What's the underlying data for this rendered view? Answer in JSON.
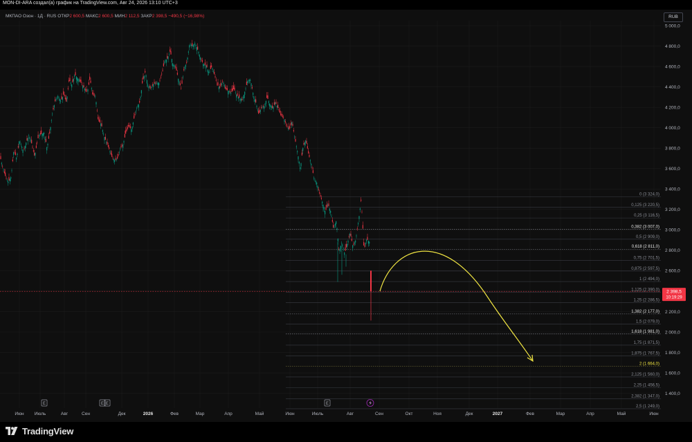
{
  "header": {
    "title": "MON-DI-ARA создал(а) график на TradingView.com, Авг 24, 2026 13:10 UTC+3"
  },
  "legend": {
    "symbol": "МКПАО Озон · 1Д · RUS",
    "open_label": "ОТКР",
    "open_value": "2 600,5",
    "high_label": "МАКС",
    "high_value": "2 600,5",
    "low_label": "МИН",
    "low_value": "2 112,5",
    "close_label": "ЗАКР",
    "close_value": "2 398,5",
    "change": "−490,5 (−16,98%)"
  },
  "currency": "RUB",
  "price_marker": {
    "price": "2 398,5",
    "countdown": "10:19:29",
    "color": "#f23645"
  },
  "brand": {
    "name": "TradingView"
  },
  "chart_data": {
    "type": "candlestick",
    "y_axis": {
      "ticks": [
        "5 000,0",
        "4 800,0",
        "4 600,0",
        "4 400,0",
        "4 200,0",
        "4 000,0",
        "3 800,0",
        "3 600,0",
        "3 400,0",
        "3 200,0",
        "3 000,0",
        "2 800,0",
        "2 600,0",
        "2 400,0",
        "2 200,0",
        "2 000,0",
        "1 800,0",
        "1 600,0",
        "1 400,0"
      ],
      "values": [
        5000,
        4800,
        4600,
        4400,
        4200,
        4000,
        3800,
        3600,
        3400,
        3200,
        3000,
        2800,
        2600,
        2400,
        2200,
        2000,
        1800,
        1600,
        1400
      ],
      "range": [
        1320,
        5030
      ]
    },
    "x_axis": {
      "ticks": [
        "Июн",
        "Июль",
        "Авг",
        "Сен",
        "Дек",
        "2026",
        "Фев",
        "Мар",
        "Апр",
        "Май",
        "Июн",
        "Июль",
        "Авг",
        "Сен",
        "Окт",
        "Ноя",
        "Дек",
        "2027",
        "Фев",
        "Мар",
        "Апр",
        "Май",
        "Июн"
      ]
    },
    "price_path": [
      [
        0,
        3720
      ],
      [
        4,
        3610
      ],
      [
        8,
        3520
      ],
      [
        12,
        3470
      ],
      [
        16,
        3520
      ],
      [
        20,
        3780
      ],
      [
        24,
        3700
      ],
      [
        28,
        3880
      ],
      [
        34,
        3770
      ],
      [
        38,
        3860
      ],
      [
        42,
        3930
      ],
      [
        46,
        3840
      ],
      [
        50,
        3720
      ],
      [
        56,
        3930
      ],
      [
        60,
        3940
      ],
      [
        64,
        3950
      ],
      [
        68,
        3800
      ],
      [
        72,
        3960
      ],
      [
        76,
        4150
      ],
      [
        80,
        4270
      ],
      [
        84,
        4310
      ],
      [
        88,
        4260
      ],
      [
        92,
        4330
      ],
      [
        96,
        4250
      ],
      [
        100,
        4470
      ],
      [
        104,
        4420
      ],
      [
        108,
        4520
      ],
      [
        112,
        4490
      ],
      [
        116,
        4450
      ],
      [
        120,
        4410
      ],
      [
        126,
        4340
      ],
      [
        130,
        4480
      ],
      [
        134,
        4320
      ],
      [
        138,
        4310
      ],
      [
        142,
        4070
      ],
      [
        146,
        4040
      ],
      [
        150,
        3930
      ],
      [
        154,
        3850
      ],
      [
        158,
        3790
      ],
      [
        162,
        3710
      ],
      [
        166,
        3680
      ],
      [
        170,
        3700
      ],
      [
        174,
        3800
      ],
      [
        178,
        3840
      ],
      [
        182,
        3950
      ],
      [
        186,
        4020
      ],
      [
        190,
        3980
      ],
      [
        194,
        4100
      ],
      [
        198,
        4200
      ],
      [
        202,
        4250
      ],
      [
        206,
        4450
      ],
      [
        210,
        4550
      ],
      [
        214,
        4410
      ],
      [
        218,
        4390
      ],
      [
        222,
        4430
      ],
      [
        226,
        4440
      ],
      [
        230,
        4440
      ],
      [
        234,
        4530
      ],
      [
        238,
        4650
      ],
      [
        242,
        4680
      ],
      [
        246,
        4750
      ],
      [
        250,
        4620
      ],
      [
        254,
        4590
      ],
      [
        258,
        4470
      ],
      [
        262,
        4380
      ],
      [
        266,
        4580
      ],
      [
        270,
        4640
      ],
      [
        274,
        4820
      ],
      [
        278,
        4800
      ],
      [
        282,
        4830
      ],
      [
        286,
        4760
      ],
      [
        290,
        4680
      ],
      [
        294,
        4620
      ],
      [
        298,
        4610
      ],
      [
        302,
        4540
      ],
      [
        306,
        4600
      ],
      [
        310,
        4520
      ],
      [
        314,
        4420
      ],
      [
        318,
        4390
      ],
      [
        322,
        4460
      ],
      [
        326,
        4380
      ],
      [
        330,
        4360
      ],
      [
        334,
        4340
      ],
      [
        338,
        4380
      ],
      [
        342,
        4320
      ],
      [
        346,
        4290
      ],
      [
        350,
        4270
      ],
      [
        354,
        4360
      ],
      [
        358,
        4460
      ],
      [
        362,
        4470
      ],
      [
        366,
        4330
      ],
      [
        370,
        4240
      ],
      [
        374,
        4130
      ],
      [
        378,
        4200
      ],
      [
        382,
        4210
      ],
      [
        386,
        4300
      ],
      [
        390,
        4230
      ],
      [
        394,
        4190
      ],
      [
        398,
        4250
      ],
      [
        402,
        4190
      ],
      [
        406,
        4120
      ],
      [
        410,
        4100
      ],
      [
        414,
        4020
      ],
      [
        418,
        3980
      ],
      [
        422,
        4060
      ],
      [
        426,
        3900
      ],
      [
        430,
        3760
      ],
      [
        434,
        3600
      ],
      [
        438,
        3820
      ],
      [
        442,
        3880
      ],
      [
        446,
        3740
      ],
      [
        450,
        3640
      ],
      [
        454,
        3500
      ],
      [
        458,
        3460
      ],
      [
        462,
        3350
      ],
      [
        466,
        3270
      ],
      [
        470,
        3180
      ],
      [
        474,
        3250
      ],
      [
        478,
        3180
      ],
      [
        482,
        3010
      ],
      [
        486,
        3090
      ],
      [
        490,
        2790
      ],
      [
        494,
        2880
      ],
      [
        498,
        2770
      ],
      [
        502,
        2870
      ],
      [
        506,
        2970
      ],
      [
        510,
        2840
      ],
      [
        514,
        2900
      ],
      [
        518,
        3080
      ],
      [
        522,
        3300
      ],
      [
        526,
        2810
      ],
      [
        530,
        2910
      ],
      [
        534,
        2880
      ]
    ],
    "last_candle": {
      "open": 2600.5,
      "high": 2600.5,
      "low": 2112.5,
      "close": 2398.5
    },
    "fib_levels": [
      {
        "label": "0 (3 324,0)",
        "value": 3324.0
      },
      {
        "label": "0,125 (3 220,5)",
        "value": 3220.5
      },
      {
        "label": "0,25 (3 116,5)",
        "value": 3116.5
      },
      {
        "label": "0,382 (3 007,0)",
        "value": 3007.0
      },
      {
        "label": "0,5 (2 909,0)",
        "value": 2909.0
      },
      {
        "label": "0,618 (2 811,0)",
        "value": 2811.0
      },
      {
        "label": "0,75 (2 701,5)",
        "value": 2701.5
      },
      {
        "label": "0,875 (2 597,5)",
        "value": 2597.5
      },
      {
        "label": "1 (2 494,0)",
        "value": 2494.0
      },
      {
        "label": "1,125 (2 390,0)",
        "value": 2390.0
      },
      {
        "label": "1,25 (2 286,5)",
        "value": 2286.5
      },
      {
        "label": "1,382 (2 177,0)",
        "value": 2177.0
      },
      {
        "label": "1,5 (2 079,0)",
        "value": 2079.0
      },
      {
        "label": "1,618 (1 981,0)",
        "value": 1981.0
      },
      {
        "label": "1,75 (1 871,5)",
        "value": 1871.5
      },
      {
        "label": "1,875 (1 767,5)",
        "value": 1767.5
      },
      {
        "label": "2 (1 664,0)",
        "value": 1664.0
      },
      {
        "label": "2,125 (1 560,0)",
        "value": 1560.0
      },
      {
        "label": "2,25 (1 456,5)",
        "value": 1456.5
      },
      {
        "label": "2,382 (1 347,0)",
        "value": 1347.0
      },
      {
        "label": "2,5 (1 249,0)",
        "value": 1249.0
      }
    ],
    "fib_bold_labels": [
      "0,382 (3 007,0)",
      "0,618 (2 811,0)",
      "1,382 (2 177,0)",
      "1,618 (1 981,0)"
    ],
    "fib_highlight_label": "2 (1 664,0)",
    "forecast_arrow": {
      "color": "#f0e442",
      "from": "Сен 2026 ~2 500",
      "peak": "Окт 2026 ~2 800",
      "to": "Фев 2027 ~1 650"
    },
    "events": {
      "earnings_label": "E",
      "dividend_icon": "lightning-icon"
    },
    "colors": {
      "up": "#089981",
      "down": "#f23645",
      "background": "#0f0f0f",
      "grid": "#1c1c1c"
    }
  }
}
